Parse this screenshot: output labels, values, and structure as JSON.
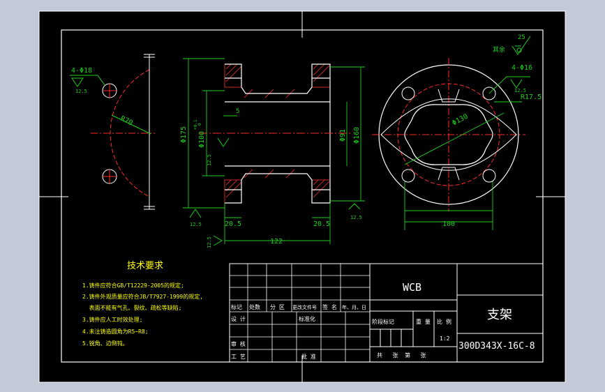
{
  "colors": {
    "background": "#c3c9d6",
    "paper": "#000000",
    "line": "#ffffff",
    "centerline": "#ff2a2a",
    "dimension": "#1fcf1f",
    "hatch": "#ff3030",
    "title_text": "#ffffff",
    "notes_text": "#ffff00"
  },
  "front_view": {
    "hole_callout": "4-Φ18",
    "hole_roughness": "12.5",
    "radius_label": "R70"
  },
  "section_view": {
    "dim_outer": "Φ175",
    "dim_bore": "Φ100",
    "dim_bore_tol": "+0.1\n0",
    "dim_bore_tol_upper": "+0.1",
    "dim_bore_tol_lower": "0",
    "dim_inner": "Φ91",
    "dim_flange": "Φ160",
    "dim_step": "5",
    "dim_left_flange": "20.5",
    "dim_right_flange": "20.5",
    "dim_length": "122",
    "roughness_bore": "12.5",
    "roughness_left": "12.5",
    "roughness_right": "12.5",
    "roughness_bottom": "12.5"
  },
  "side_view": {
    "hole_callout": "4-Φ16",
    "hole_roughness": "12.5",
    "radius_label": "R17.5",
    "pcd_label": "Φ130",
    "width_label": "100",
    "remainder_label": "其余",
    "remainder_roughness": "25"
  },
  "tech_notes": {
    "heading": "技术要求",
    "items": [
      "1.铸件应符合GB/T12229-2005的规定;",
      "2.铸件外观质量应符合JB/T7927-1999的规定,",
      "  表面不能有气孔、裂纹、疏松等缺陷;",
      "3.铸件应人工时效处理;",
      "4.未注铸造圆角为R5~R8;",
      "5.锐角、边倒钝。"
    ]
  },
  "title_block": {
    "material": "WCB",
    "part_name": "支架",
    "drawing_number": "300D343X-16C-8",
    "scale": "1:2",
    "labels": {
      "mark": "标记",
      "count": "处数",
      "zone": "分 区",
      "change_doc": "更改文件号",
      "sign": "签 名",
      "date": "年、月、日",
      "design": "设 计",
      "standardize": "标准化",
      "stage_mark": "阶段标记",
      "weight": "重 量",
      "scale": "比 例",
      "review": "审 核",
      "process": "工 艺",
      "approve": "批 准",
      "sheets": "共   张  第   张"
    }
  }
}
